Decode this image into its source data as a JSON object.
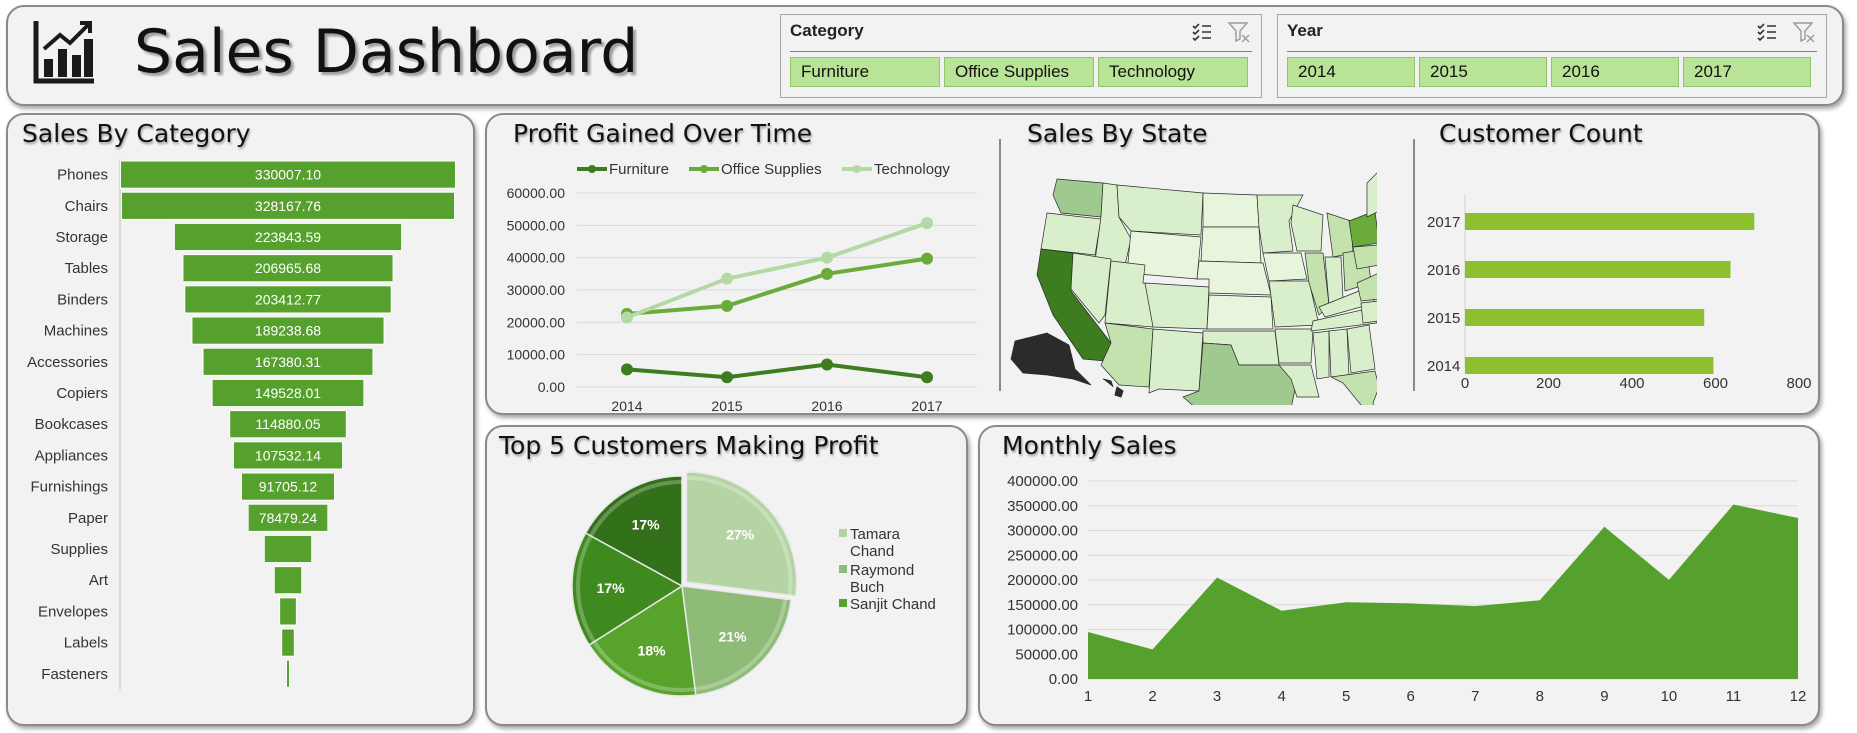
{
  "header": {
    "title": "Sales Dashboard",
    "icon": "bar-chart-icon",
    "category_slicer": {
      "label": "Category",
      "options": [
        "Furniture",
        "Office Supplies",
        "Technology"
      ]
    },
    "year_slicer": {
      "label": "Year",
      "options": [
        "2014",
        "2015",
        "2016",
        "2017"
      ]
    }
  },
  "panels": {
    "sales_by_category": "Sales By Category",
    "profit_over_time": "Profit Gained Over Time",
    "sales_by_state": "Sales By State",
    "customer_count": "Customer Count",
    "top_customers": "Top 5 Customers Making Profit",
    "monthly_sales": "Monthly Sales"
  },
  "colors": {
    "dark_green": "#3d7d1f",
    "green": "#56a12d",
    "mid_green": "#6aab3b",
    "light_green": "#9fc98e",
    "pale_green": "#d9efcb",
    "lime": "#8dc02e",
    "slicer_fill": "#b9e396"
  },
  "chart_data": [
    {
      "id": "sales_by_category",
      "type": "bar",
      "title": "Sales By Category",
      "categories": [
        "Phones",
        "Chairs",
        "Storage",
        "Tables",
        "Binders",
        "Machines",
        "Accessories",
        "Copiers",
        "Bookcases",
        "Appliances",
        "Furnishings",
        "Paper",
        "Supplies",
        "Art",
        "Envelopes",
        "Labels",
        "Fasteners"
      ],
      "values": [
        330007.1,
        328167.76,
        223843.59,
        206965.68,
        203412.77,
        189238.68,
        167380.31,
        149528.01,
        114880.05,
        107532.14,
        91705.12,
        78479.24,
        46673.54,
        27118.79,
        16476.4,
        12486.31,
        3024.28
      ],
      "labels": [
        "330007.10",
        "328167.76",
        "223843.59",
        "206965.68",
        "203412.77",
        "189238.68",
        "167380.31",
        "149528.01",
        "114880.05",
        "107532.14",
        "91705.12",
        "78479.24",
        "",
        "",
        "",
        "",
        ""
      ],
      "xlabel": "",
      "ylabel": ""
    },
    {
      "id": "profit_over_time",
      "type": "line",
      "title": "Profit Gained Over Time",
      "categories": [
        "2014",
        "2015",
        "2016",
        "2017"
      ],
      "series": [
        {
          "name": "Furniture",
          "values": [
            5460,
            3015,
            6960,
            3020
          ]
        },
        {
          "name": "Office Supplies",
          "values": [
            22600,
            25100,
            35000,
            39700
          ]
        },
        {
          "name": "Technology",
          "values": [
            21500,
            33500,
            40000,
            50700
          ]
        }
      ],
      "yticks": [
        "0.00",
        "10000.00",
        "20000.00",
        "30000.00",
        "40000.00",
        "50000.00",
        "60000.00"
      ],
      "ylim": [
        0,
        60000
      ],
      "legend": "top"
    },
    {
      "id": "sales_by_state",
      "type": "map",
      "title": "Sales By State"
    },
    {
      "id": "customer_count",
      "type": "bar",
      "title": "Customer Count",
      "categories": [
        "2017",
        "2016",
        "2015",
        "2014"
      ],
      "values": [
        693,
        636,
        573,
        595
      ],
      "xticks": [
        "0",
        "200",
        "400",
        "600",
        "800"
      ],
      "xlim": [
        0,
        800
      ]
    },
    {
      "id": "top_customers",
      "type": "pie",
      "title": "Top 5 Customers Making Profit",
      "slices": [
        {
          "name": "Tamara Chand",
          "value": 27,
          "label": "27%"
        },
        {
          "name": "Raymond Buch",
          "value": 21,
          "label": "21%"
        },
        {
          "name": "Sanjit Chand",
          "value": 18,
          "label": "18%"
        },
        {
          "name": "",
          "value": 17,
          "label": "17%"
        },
        {
          "name": "",
          "value": 17,
          "label": "17%"
        }
      ],
      "legend": [
        "Tamara Chand",
        "Raymond Buch",
        "Sanjit Chand"
      ]
    },
    {
      "id": "monthly_sales",
      "type": "area",
      "title": "Monthly Sales",
      "categories": [
        "1",
        "2",
        "3",
        "4",
        "5",
        "6",
        "7",
        "8",
        "9",
        "10",
        "11",
        "12"
      ],
      "values": [
        94925,
        59751,
        205005,
        137762,
        155028,
        152719,
        147238,
        159044,
        307649,
        200322,
        352461,
        325293
      ],
      "yticks": [
        "0.00",
        "50000.00",
        "100000.00",
        "150000.00",
        "200000.00",
        "250000.00",
        "300000.00",
        "350000.00",
        "400000.00"
      ],
      "ylim": [
        0,
        400000
      ]
    }
  ]
}
